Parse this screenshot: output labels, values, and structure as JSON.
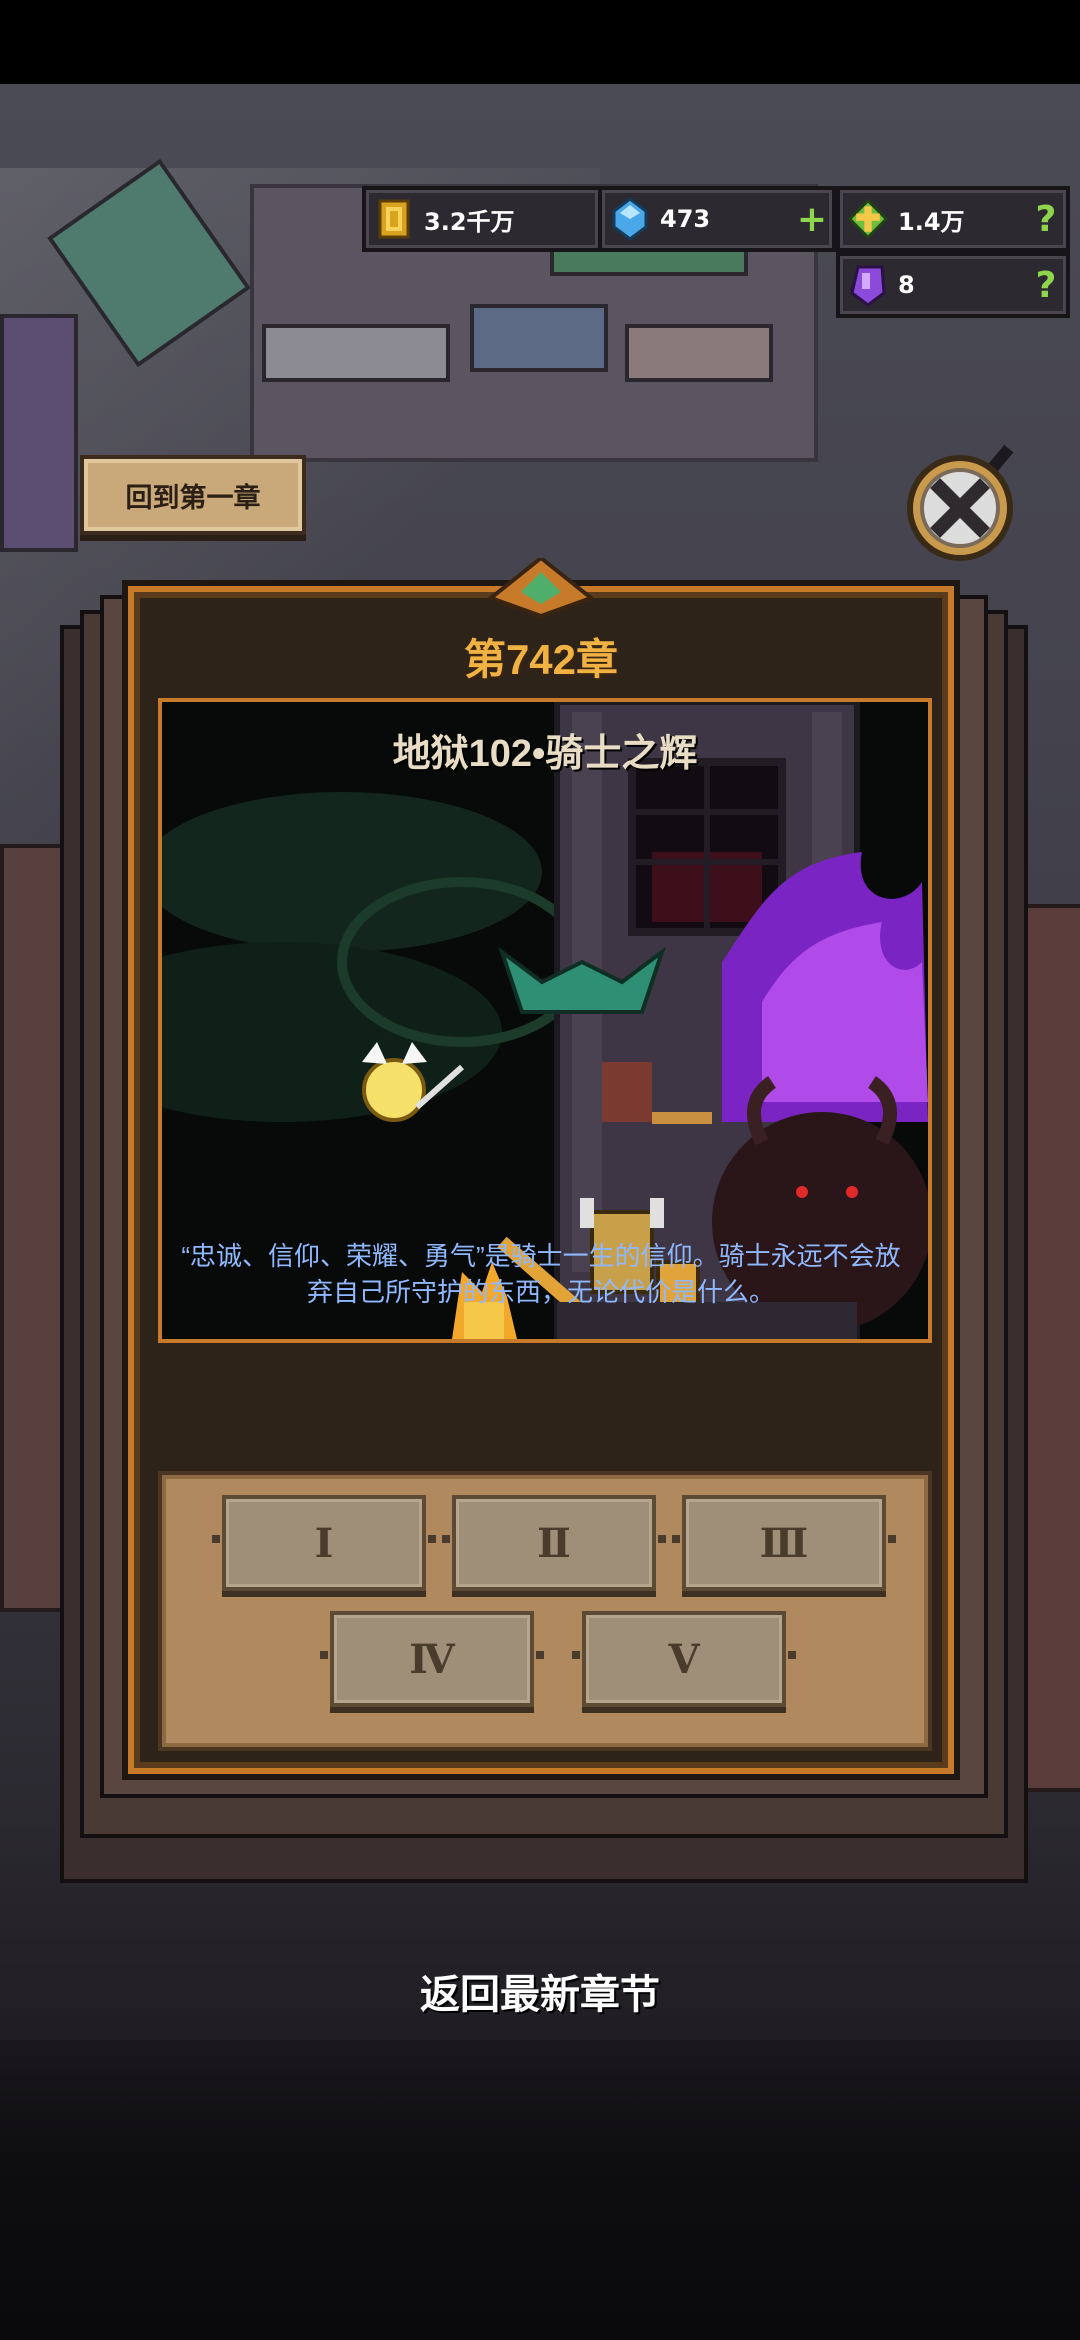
{
  "currencies": {
    "gold": {
      "icon": "gold-coin-icon",
      "value": "3.2千万"
    },
    "gems": {
      "icon": "blue-gem-icon",
      "value": "473",
      "action": "+"
    },
    "holy": {
      "icon": "golden-cross-icon",
      "value": "1.4万",
      "action": "?"
    },
    "crystal": {
      "icon": "purple-crystal-icon",
      "value": "8",
      "action": "?"
    }
  },
  "nav": {
    "back_to_first": "回到第一章",
    "close_icon": "close-magnifier-icon",
    "back_to_latest": "返回最新章节"
  },
  "chapter": {
    "title": "第742章",
    "stage_title": "地狱102•骑士之辉",
    "story": "“忠诚、信仰、荣耀、勇气”是骑士一生的信仰。骑士永远不会放弃自己所守护的东西，无论代价是什么。",
    "difficulties": [
      "Ⅰ",
      "Ⅱ",
      "Ⅲ",
      "Ⅳ",
      "Ⅴ"
    ]
  },
  "colors": {
    "frame_orange": "#c67a2a",
    "title_gold": "#f0b343",
    "story_blue": "#8fb8ff",
    "plus_green": "#8fd44d"
  }
}
